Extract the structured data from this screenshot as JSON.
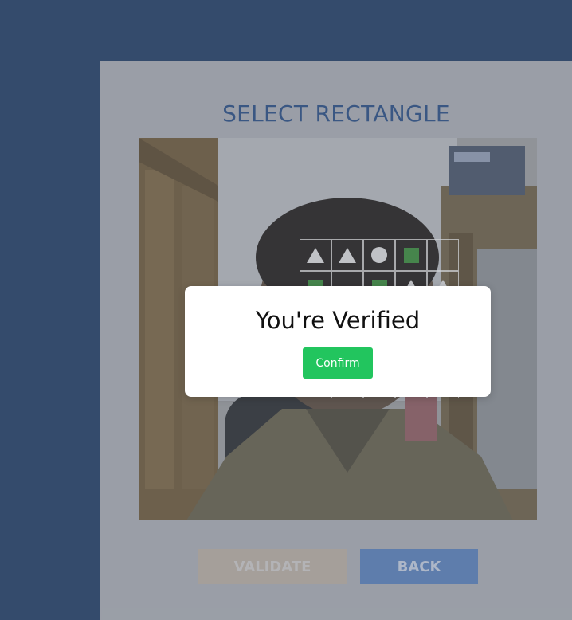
{
  "page": {
    "title": "SELECT RECTANGLE"
  },
  "camera": {
    "grid": [
      [
        "triangle",
        "triangle",
        "circle",
        "square",
        "empty"
      ],
      [
        "square",
        "empty",
        "square",
        "triangle",
        "triangle"
      ],
      [
        "empty",
        "empty",
        "empty",
        "empty",
        "empty"
      ],
      [
        "empty",
        "empty",
        "empty",
        "empty",
        "empty"
      ],
      [
        "empty",
        "empty",
        "empty",
        "empty",
        "empty"
      ]
    ]
  },
  "buttons": {
    "validate_label": "VALIDATE",
    "back_label": "BACK"
  },
  "modal": {
    "title": "You're Verified",
    "confirm_label": "Confirm"
  },
  "colors": {
    "background": "#253f65",
    "panel": "#a7aab0",
    "title": "#2c4f82",
    "confirm": "#22c55e",
    "back": "#5a7fb6",
    "validate": "#b5ab9f"
  }
}
